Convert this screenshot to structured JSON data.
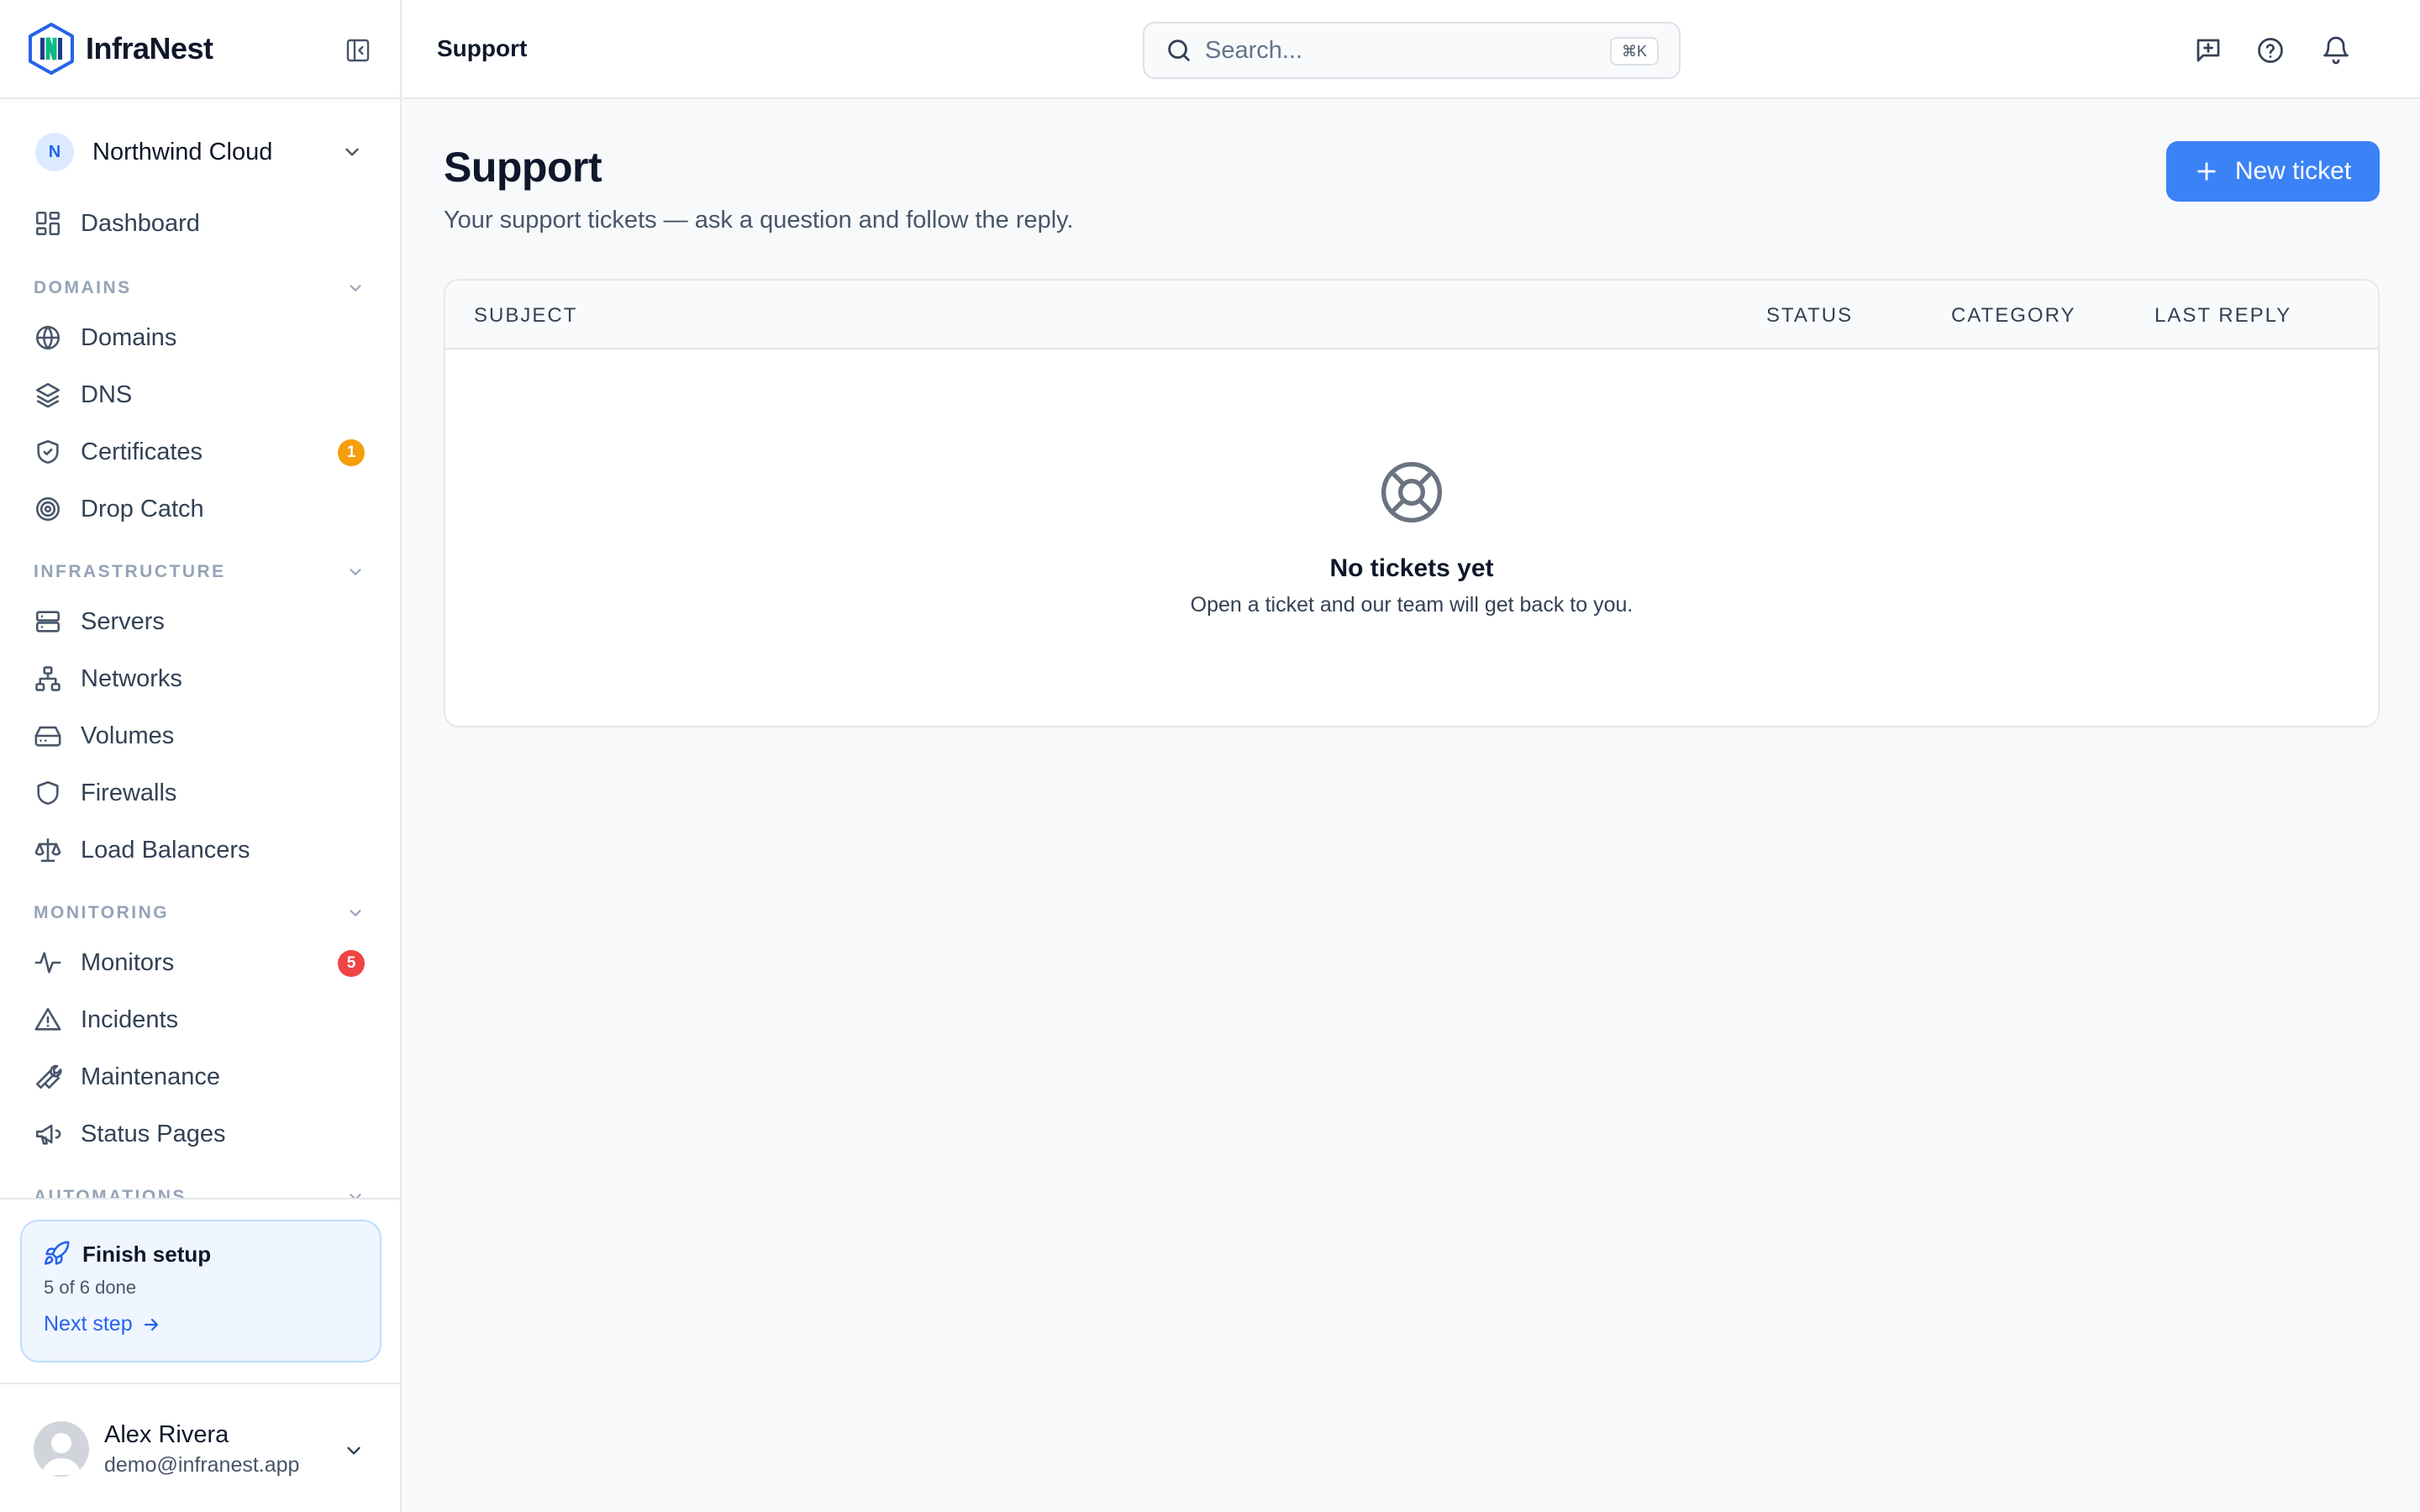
{
  "app": {
    "name": "InfraNest"
  },
  "org": {
    "initial": "N",
    "name": "Northwind Cloud"
  },
  "nav": {
    "dashboard": "Dashboard",
    "sections": {
      "domains": "DOMAINS",
      "infrastructure": "INFRASTRUCTURE",
      "monitoring": "MONITORING",
      "automations": "AUTOMATIONS"
    },
    "items": {
      "domains": "Domains",
      "dns": "DNS",
      "certificates": "Certificates",
      "drop_catch": "Drop Catch",
      "servers": "Servers",
      "networks": "Networks",
      "volumes": "Volumes",
      "firewalls": "Firewalls",
      "load_balancers": "Load Balancers",
      "monitors": "Monitors",
      "incidents": "Incidents",
      "maintenance": "Maintenance",
      "status_pages": "Status Pages"
    },
    "badges": {
      "certificates": "1",
      "monitors": "5"
    }
  },
  "setup": {
    "title": "Finish setup",
    "progress": "5 of 6 done",
    "link": "Next step"
  },
  "user": {
    "name": "Alex Rivera",
    "email": "demo@infranest.app"
  },
  "topbar": {
    "breadcrumb": "Support",
    "search_placeholder": "Search...",
    "shortcut": "⌘K"
  },
  "page": {
    "title": "Support",
    "subtitle": "Your support tickets — ask a question and follow the reply.",
    "new_button": "New ticket"
  },
  "table": {
    "columns": [
      "SUBJECT",
      "STATUS",
      "CATEGORY",
      "LAST REPLY"
    ],
    "rows": [],
    "empty_title": "No tickets yet",
    "empty_subtitle": "Open a ticket and our team will get back to you."
  },
  "colors": {
    "accent": "#3b82f6",
    "badge_warning": "#f59e0b",
    "badge_danger": "#ef4444"
  }
}
